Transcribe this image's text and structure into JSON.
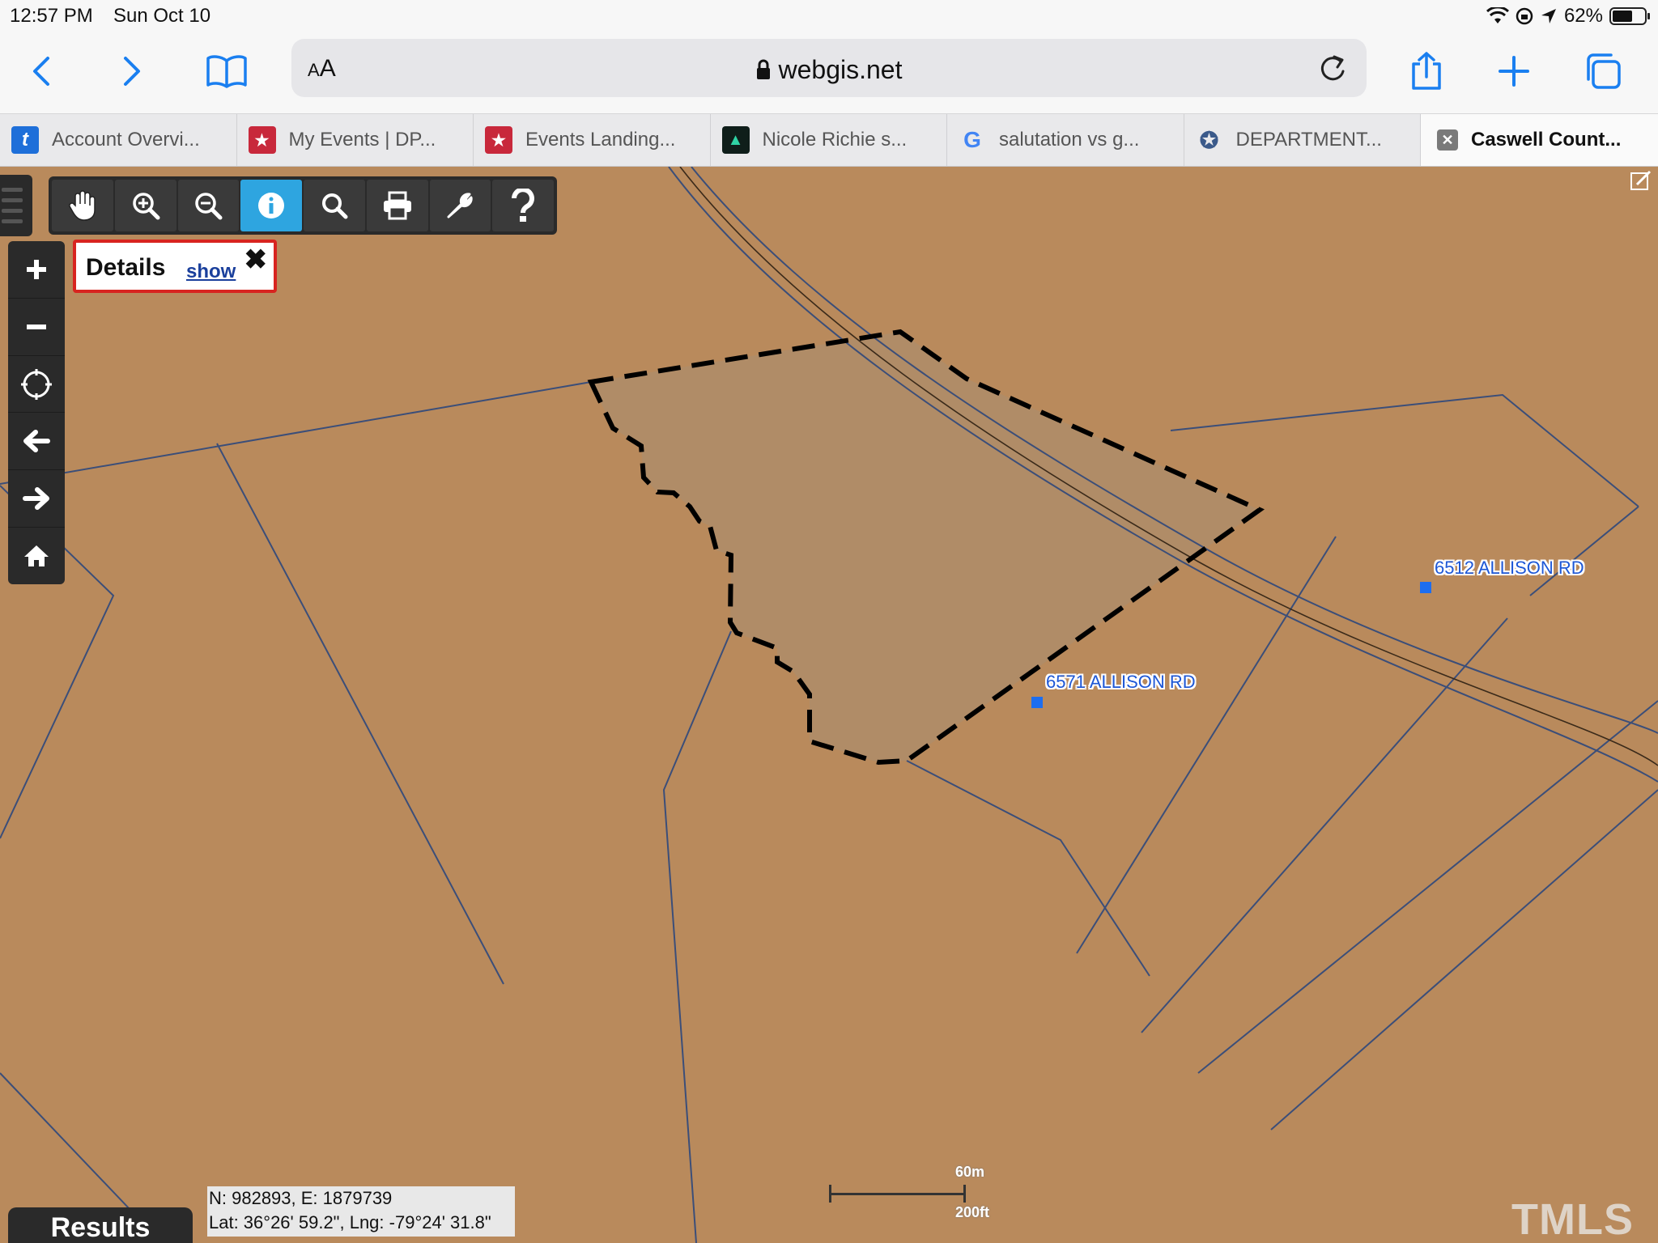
{
  "status_bar": {
    "time": "12:57 PM",
    "date": "Sun Oct 10",
    "battery": "62%",
    "battery_level": 0.62
  },
  "browser": {
    "text_size_label": "AA",
    "url": "webgis.net",
    "icons": [
      "back-icon",
      "forward-icon",
      "bookmarks-icon",
      "lock-icon",
      "reload-icon",
      "share-icon",
      "new-tab-icon",
      "tabs-overview-icon"
    ]
  },
  "tabs": [
    {
      "label": "Account Overvi...",
      "favicon": "t",
      "color": "#1e6fd9"
    },
    {
      "label": "My Events | DP...",
      "favicon": "★",
      "color": "#c8283b"
    },
    {
      "label": "Events Landing...",
      "favicon": "★",
      "color": "#c8283b"
    },
    {
      "label": "Nicole Richie s...",
      "favicon": "▲",
      "color": "#0f1e1a"
    },
    {
      "label": "salutation vs g...",
      "favicon": "G",
      "color": "#4285f4"
    },
    {
      "label": "DEPARTMENT...",
      "favicon": "✪",
      "color": "#3b5a8a"
    },
    {
      "label": "Caswell Count...",
      "favicon": "✕",
      "color": "#6b6b6b"
    }
  ],
  "map": {
    "tools": [
      "pan-icon",
      "zoom-in-icon",
      "zoom-out-icon",
      "info-icon",
      "search-icon",
      "print-icon",
      "wrench-icon",
      "help-icon"
    ],
    "active_tool": "info-icon",
    "nav_buttons": [
      "plus-icon",
      "minus-icon",
      "locate-icon",
      "arrow-left-icon",
      "arrow-right-icon",
      "home-icon"
    ],
    "details": {
      "title": "Details",
      "show": "show"
    },
    "labels": [
      {
        "text": "6571 ALLISON RD"
      },
      {
        "text": "6512 ALLISON RD"
      }
    ],
    "results_label": "Results",
    "coords": {
      "line1": "N: 982893, E: 1879739",
      "line2": "Lat: 36°26' 59.2\", Lng: -79°24' 31.8\""
    },
    "scale": {
      "metric": "60m",
      "imperial": "200ft"
    },
    "watermark": "TMLS",
    "colors": {
      "background": "#b98a5c",
      "selected_parcel": "#b08c67",
      "parcel_lines": "#3b4e79"
    }
  }
}
